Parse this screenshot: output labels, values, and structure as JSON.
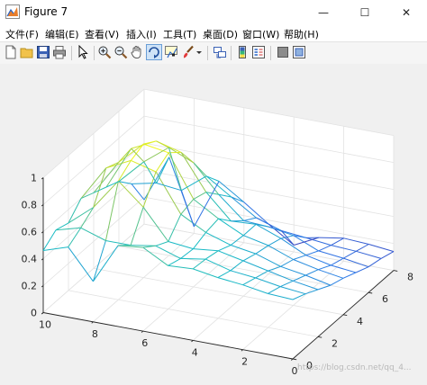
{
  "window": {
    "title": "Figure 7",
    "minimize_glyph": "—",
    "maximize_glyph": "☐",
    "close_glyph": "✕"
  },
  "menu": [
    {
      "label": "文件(F)"
    },
    {
      "label": "编辑(E)"
    },
    {
      "label": "查看(V)"
    },
    {
      "label": "插入(I)"
    },
    {
      "label": "工具(T)"
    },
    {
      "label": "桌面(D)"
    },
    {
      "label": "窗口(W)"
    },
    {
      "label": "帮助(H)"
    }
  ],
  "toolbar": {
    "buttons": [
      "new-figure-icon",
      "open-file-icon",
      "save-icon",
      "print-icon",
      "pointer-icon",
      "zoom-in-icon",
      "zoom-out-icon",
      "pan-icon",
      "rotate-3d-icon",
      "data-cursor-icon",
      "brush-icon",
      "link-plot-icon",
      "colorbar-icon",
      "legend-icon",
      "hide-plot-tools-icon",
      "show-plot-tools-icon"
    ]
  },
  "chart_data": {
    "type": "mesh",
    "title": "",
    "x": [
      0,
      1,
      2,
      3,
      4,
      5,
      6,
      7,
      8,
      9,
      10
    ],
    "y": [
      0,
      1,
      2,
      3,
      4,
      5,
      6,
      7,
      8
    ],
    "xlim": [
      0,
      10
    ],
    "ylim": [
      0,
      8
    ],
    "zlim": [
      0,
      1
    ],
    "xticks": [
      "0",
      "2",
      "4",
      "6",
      "8",
      "10"
    ],
    "yticks": [
      "0",
      "2",
      "4",
      "6",
      "8"
    ],
    "zticks": [
      "0",
      "0.2",
      "0.4",
      "0.6",
      "0.8",
      "1"
    ],
    "grid": true,
    "colormap": "parula",
    "z": [
      [
        0.44,
        0.45,
        0.48,
        0.5,
        0.53,
        0.52,
        0.62,
        0.6,
        0.3,
        0.52,
        0.46
      ],
      [
        0.4,
        0.42,
        0.45,
        0.47,
        0.52,
        0.49,
        0.55,
        0.52,
        0.52,
        0.58,
        0.53
      ],
      [
        0.35,
        0.38,
        0.42,
        0.46,
        0.5,
        0.48,
        0.5,
        0.72,
        0.88,
        0.65,
        0.5
      ],
      [
        0.3,
        0.34,
        0.37,
        0.43,
        0.46,
        0.52,
        0.62,
        0.9,
        0.95,
        0.86,
        0.6
      ],
      [
        0.27,
        0.3,
        0.34,
        0.41,
        0.45,
        0.54,
        0.65,
        0.96,
        0.99,
        0.82,
        0.56
      ],
      [
        0.23,
        0.25,
        0.29,
        0.38,
        0.45,
        0.44,
        0.62,
        0.88,
        0.93,
        0.84,
        0.52
      ],
      [
        0.19,
        0.22,
        0.24,
        0.32,
        0.35,
        0.36,
        0.52,
        0.72,
        0.8,
        0.66,
        0.48
      ],
      [
        0.17,
        0.19,
        0.2,
        0.22,
        0.24,
        0.3,
        0.42,
        0.54,
        0.4,
        0.42,
        0.38
      ],
      [
        0.14,
        0.16,
        0.17,
        0.14,
        0.05,
        0.17,
        0.3,
        0.42,
        0.05,
        0.53,
        0.18
      ]
    ]
  },
  "watermark": "https://blog.csdn.net/qq_4..."
}
